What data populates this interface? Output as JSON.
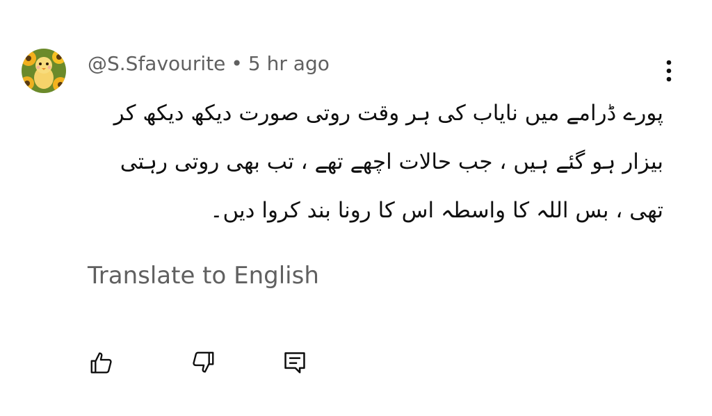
{
  "comment": {
    "author": "@S.Sfavourite",
    "separator": "•",
    "time": "5 hr ago",
    "text": "پورے ڈرامے میں نایاب کی ہر وقت روتی صورت دیکھ دیکھ کر بیزار ہو گئے ہیں ، جب حالات اچھے تھے ، تب بھی روتی رہتی تھی ، بس اللہ کا واسطہ اس کا رونا بند کروا دیں۔",
    "translate_label": "Translate to English"
  },
  "icons": {
    "avatar": "avatar-sunflower-chick",
    "more": "more-vert-icon",
    "like": "thumb-up-icon",
    "dislike": "thumb-down-icon",
    "reply": "comment-reply-icon"
  },
  "colors": {
    "meta_text": "#606060",
    "body_text": "#0f0f0f",
    "icon": "#0f0f0f"
  }
}
